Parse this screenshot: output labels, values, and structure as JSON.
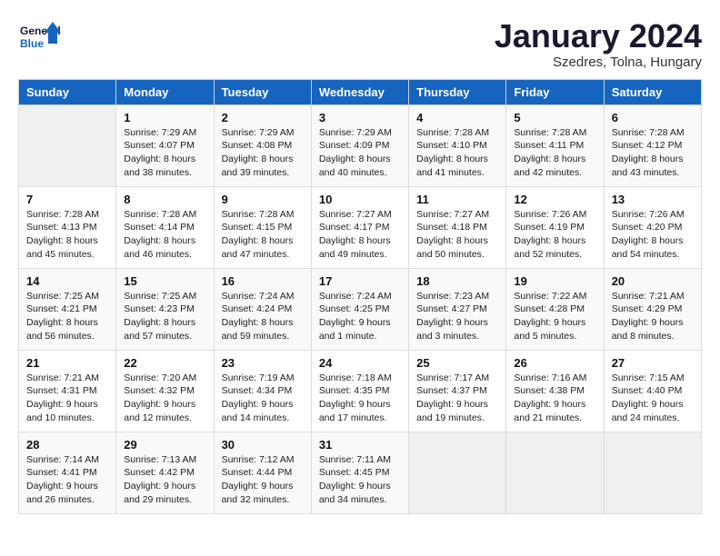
{
  "logo": {
    "line1": "General",
    "line2": "Blue"
  },
  "title": "January 2024",
  "location": "Szedres, Tolna, Hungary",
  "days_header": [
    "Sunday",
    "Monday",
    "Tuesday",
    "Wednesday",
    "Thursday",
    "Friday",
    "Saturday"
  ],
  "weeks": [
    [
      {
        "num": "",
        "info": ""
      },
      {
        "num": "1",
        "info": "Sunrise: 7:29 AM\nSunset: 4:07 PM\nDaylight: 8 hours\nand 38 minutes."
      },
      {
        "num": "2",
        "info": "Sunrise: 7:29 AM\nSunset: 4:08 PM\nDaylight: 8 hours\nand 39 minutes."
      },
      {
        "num": "3",
        "info": "Sunrise: 7:29 AM\nSunset: 4:09 PM\nDaylight: 8 hours\nand 40 minutes."
      },
      {
        "num": "4",
        "info": "Sunrise: 7:28 AM\nSunset: 4:10 PM\nDaylight: 8 hours\nand 41 minutes."
      },
      {
        "num": "5",
        "info": "Sunrise: 7:28 AM\nSunset: 4:11 PM\nDaylight: 8 hours\nand 42 minutes."
      },
      {
        "num": "6",
        "info": "Sunrise: 7:28 AM\nSunset: 4:12 PM\nDaylight: 8 hours\nand 43 minutes."
      }
    ],
    [
      {
        "num": "7",
        "info": "Sunrise: 7:28 AM\nSunset: 4:13 PM\nDaylight: 8 hours\nand 45 minutes."
      },
      {
        "num": "8",
        "info": "Sunrise: 7:28 AM\nSunset: 4:14 PM\nDaylight: 8 hours\nand 46 minutes."
      },
      {
        "num": "9",
        "info": "Sunrise: 7:28 AM\nSunset: 4:15 PM\nDaylight: 8 hours\nand 47 minutes."
      },
      {
        "num": "10",
        "info": "Sunrise: 7:27 AM\nSunset: 4:17 PM\nDaylight: 8 hours\nand 49 minutes."
      },
      {
        "num": "11",
        "info": "Sunrise: 7:27 AM\nSunset: 4:18 PM\nDaylight: 8 hours\nand 50 minutes."
      },
      {
        "num": "12",
        "info": "Sunrise: 7:26 AM\nSunset: 4:19 PM\nDaylight: 8 hours\nand 52 minutes."
      },
      {
        "num": "13",
        "info": "Sunrise: 7:26 AM\nSunset: 4:20 PM\nDaylight: 8 hours\nand 54 minutes."
      }
    ],
    [
      {
        "num": "14",
        "info": "Sunrise: 7:25 AM\nSunset: 4:21 PM\nDaylight: 8 hours\nand 56 minutes."
      },
      {
        "num": "15",
        "info": "Sunrise: 7:25 AM\nSunset: 4:23 PM\nDaylight: 8 hours\nand 57 minutes."
      },
      {
        "num": "16",
        "info": "Sunrise: 7:24 AM\nSunset: 4:24 PM\nDaylight: 8 hours\nand 59 minutes."
      },
      {
        "num": "17",
        "info": "Sunrise: 7:24 AM\nSunset: 4:25 PM\nDaylight: 9 hours\nand 1 minute."
      },
      {
        "num": "18",
        "info": "Sunrise: 7:23 AM\nSunset: 4:27 PM\nDaylight: 9 hours\nand 3 minutes."
      },
      {
        "num": "19",
        "info": "Sunrise: 7:22 AM\nSunset: 4:28 PM\nDaylight: 9 hours\nand 5 minutes."
      },
      {
        "num": "20",
        "info": "Sunrise: 7:21 AM\nSunset: 4:29 PM\nDaylight: 9 hours\nand 8 minutes."
      }
    ],
    [
      {
        "num": "21",
        "info": "Sunrise: 7:21 AM\nSunset: 4:31 PM\nDaylight: 9 hours\nand 10 minutes."
      },
      {
        "num": "22",
        "info": "Sunrise: 7:20 AM\nSunset: 4:32 PM\nDaylight: 9 hours\nand 12 minutes."
      },
      {
        "num": "23",
        "info": "Sunrise: 7:19 AM\nSunset: 4:34 PM\nDaylight: 9 hours\nand 14 minutes."
      },
      {
        "num": "24",
        "info": "Sunrise: 7:18 AM\nSunset: 4:35 PM\nDaylight: 9 hours\nand 17 minutes."
      },
      {
        "num": "25",
        "info": "Sunrise: 7:17 AM\nSunset: 4:37 PM\nDaylight: 9 hours\nand 19 minutes."
      },
      {
        "num": "26",
        "info": "Sunrise: 7:16 AM\nSunset: 4:38 PM\nDaylight: 9 hours\nand 21 minutes."
      },
      {
        "num": "27",
        "info": "Sunrise: 7:15 AM\nSunset: 4:40 PM\nDaylight: 9 hours\nand 24 minutes."
      }
    ],
    [
      {
        "num": "28",
        "info": "Sunrise: 7:14 AM\nSunset: 4:41 PM\nDaylight: 9 hours\nand 26 minutes."
      },
      {
        "num": "29",
        "info": "Sunrise: 7:13 AM\nSunset: 4:42 PM\nDaylight: 9 hours\nand 29 minutes."
      },
      {
        "num": "30",
        "info": "Sunrise: 7:12 AM\nSunset: 4:44 PM\nDaylight: 9 hours\nand 32 minutes."
      },
      {
        "num": "31",
        "info": "Sunrise: 7:11 AM\nSunset: 4:45 PM\nDaylight: 9 hours\nand 34 minutes."
      },
      {
        "num": "",
        "info": ""
      },
      {
        "num": "",
        "info": ""
      },
      {
        "num": "",
        "info": ""
      }
    ]
  ]
}
